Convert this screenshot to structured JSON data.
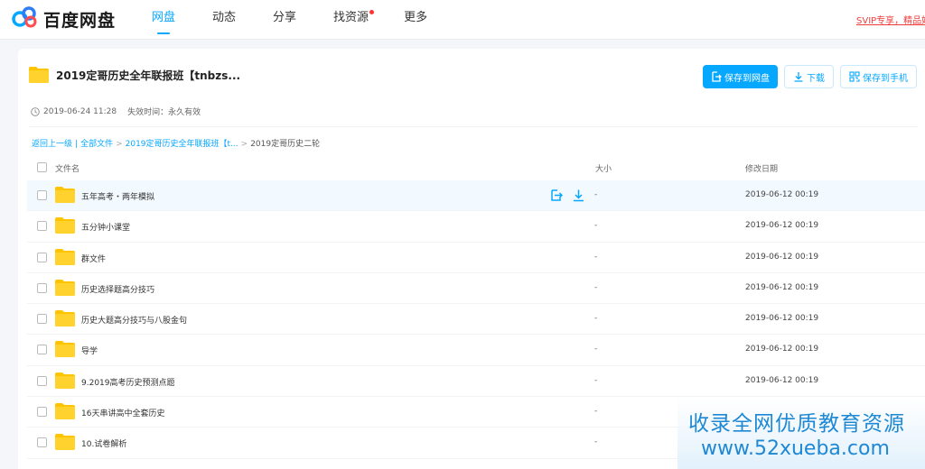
{
  "app": {
    "logo_text": "百度网盘",
    "nav": [
      {
        "label": "网盘",
        "active": true,
        "dot": false
      },
      {
        "label": "动态",
        "active": false,
        "dot": false
      },
      {
        "label": "分享",
        "active": false,
        "dot": false
      },
      {
        "label": "找资源",
        "active": false,
        "dot": true
      },
      {
        "label": "更多",
        "active": false,
        "dot": false
      }
    ],
    "promo_text": "SVIP专享，精品好"
  },
  "share": {
    "title": "2019定哥历史全年联报班【tnbzs...",
    "created": "2019-06-24 11:28",
    "expiry_label": "失效时间：",
    "expiry_value": "永久有效",
    "actions": {
      "save_to_disk": "保存到网盘",
      "download": "下载",
      "save_to_phone": "保存到手机"
    }
  },
  "breadcrumb": {
    "back": "返回上一级",
    "all_files": "全部文件",
    "parent": "2019定哥历史全年联报班【t...",
    "current": "2019定哥历史二轮"
  },
  "table": {
    "columns": {
      "name": "文件名",
      "size": "大小",
      "modified": "修改日期"
    },
    "rows": [
      {
        "name": "五年高考・两年模拟",
        "size": "-",
        "modified": "2019-06-12 00:19"
      },
      {
        "name": "五分钟小课堂",
        "size": "-",
        "modified": "2019-06-12 00:19"
      },
      {
        "name": "群文件",
        "size": "-",
        "modified": "2019-06-12 00:19"
      },
      {
        "name": "历史选择题高分技巧",
        "size": "-",
        "modified": "2019-06-12 00:19"
      },
      {
        "name": "历史大题高分技巧与八股金句",
        "size": "-",
        "modified": "2019-06-12 00:19"
      },
      {
        "name": "导学",
        "size": "-",
        "modified": "2019-06-12 00:19"
      },
      {
        "name": "9.2019高考历史预测点题",
        "size": "-",
        "modified": "2019-06-12 00:19"
      },
      {
        "name": "16天串讲高中全套历史",
        "size": "-",
        "modified": ""
      },
      {
        "name": "10.试卷解析",
        "size": "-",
        "modified": ""
      }
    ]
  },
  "watermark": {
    "line1": "收录全网优质教育资源",
    "line2": "www.52xueba.com"
  },
  "colors": {
    "accent": "#06a7ff",
    "folder": "#ffc400",
    "promo": "#f23d3d"
  },
  "icons": [
    "baidu-netdisk-logo-icon",
    "folder-icon",
    "clock-icon",
    "save-icon",
    "download-icon",
    "phone-save-icon"
  ]
}
